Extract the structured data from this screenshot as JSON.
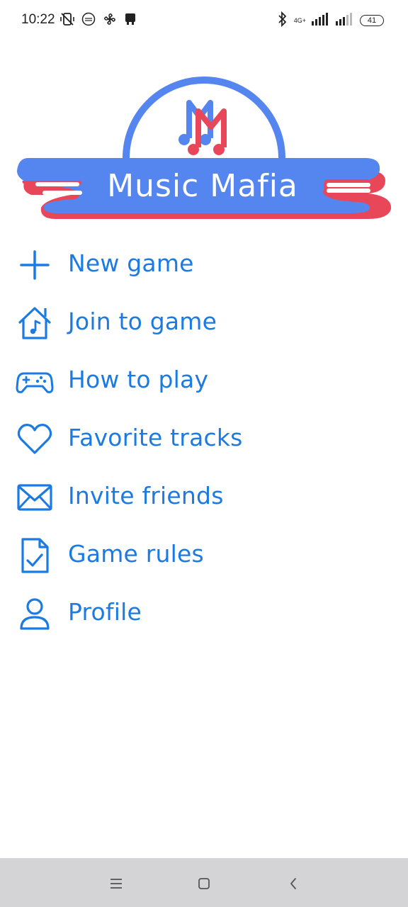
{
  "status_bar": {
    "time": "10:22",
    "network_type": "4G+",
    "battery_level": "41"
  },
  "logo": {
    "title": "Music Mafia",
    "mark": "M",
    "colors": {
      "blue": "#5585ee",
      "red": "#e8475a"
    }
  },
  "menu": {
    "accent_color": "#1c7be2",
    "items": [
      {
        "label": "New game",
        "icon": "plus-icon"
      },
      {
        "label": "Join to game",
        "icon": "house-music-icon"
      },
      {
        "label": "How to play",
        "icon": "gamepad-icon"
      },
      {
        "label": "Favorite tracks",
        "icon": "heart-icon"
      },
      {
        "label": "Invite friends",
        "icon": "envelope-icon"
      },
      {
        "label": "Game rules",
        "icon": "document-check-icon"
      },
      {
        "label": "Profile",
        "icon": "user-icon"
      }
    ]
  },
  "nav_bar": {
    "buttons": [
      "menu-icon",
      "home-square-icon",
      "back-chevron-icon"
    ]
  }
}
